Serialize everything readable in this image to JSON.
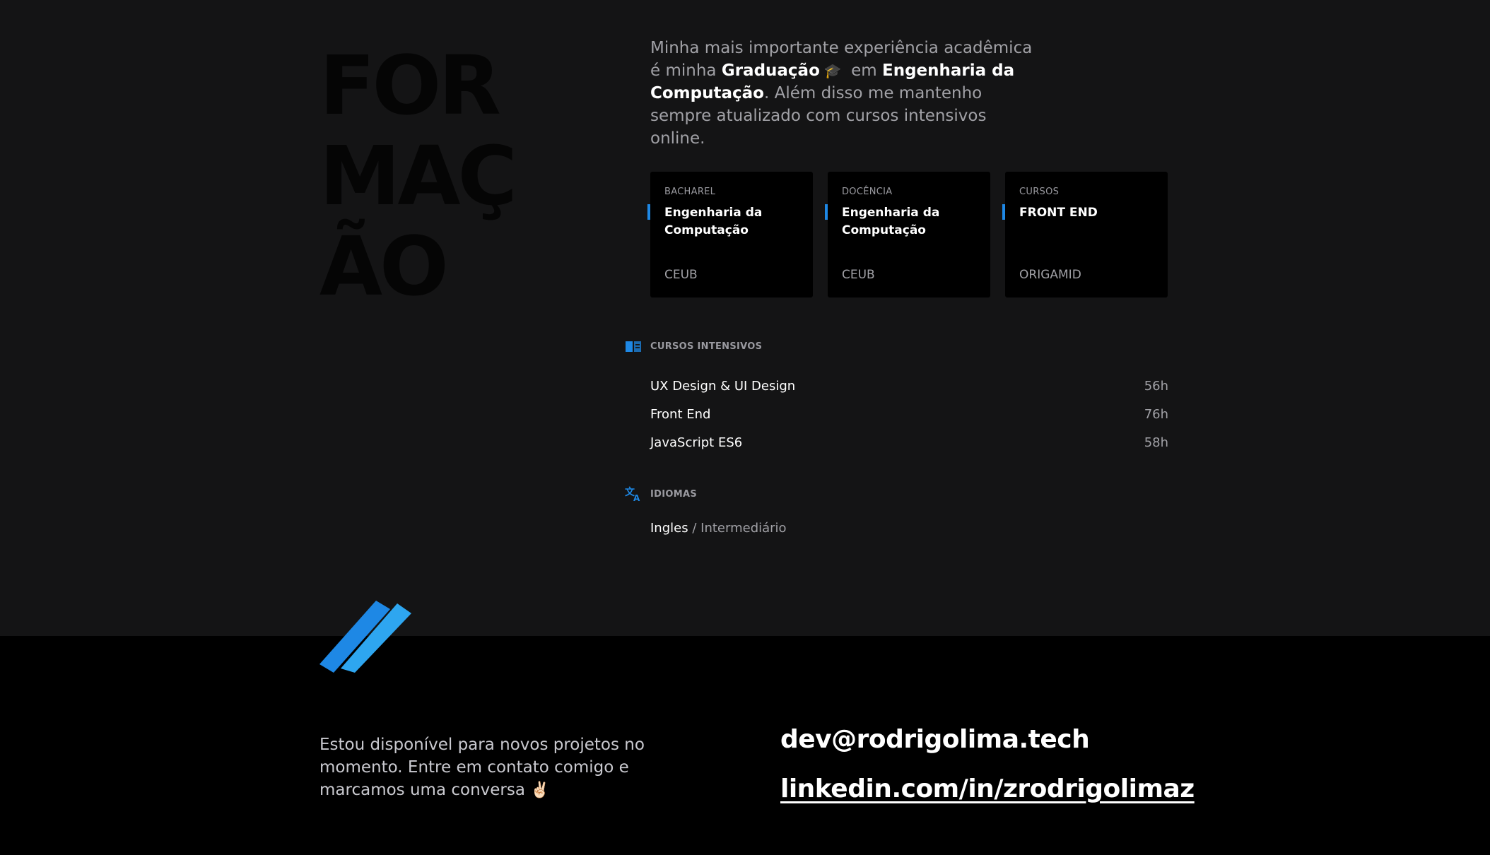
{
  "formacao": {
    "title": "FOR\nMAÇ\nÃO",
    "intro": {
      "prefix": "Minha mais importante experiência acadêmica é minha ",
      "graduacao": "Graduação",
      "emoji": "🎓",
      "em": " em ",
      "curso": "Engenharia da Computação",
      "suffix": ". Além disso me mantenho sempre atualizado com cursos intensivos online."
    },
    "cards": [
      {
        "kind": "BACHAREL",
        "degree": "Engenharia da Computação",
        "school": "CEUB"
      },
      {
        "kind": "DOCÊNCIA",
        "degree": "Engenharia da Computação",
        "school": "CEUB"
      },
      {
        "kind": "CURSOS",
        "degree": "FRONT END",
        "school": "ORIGAMID"
      }
    ],
    "cursos": {
      "label": "CURSOS INTENSIVOS",
      "icon": "book-icon",
      "items": [
        {
          "name": "UX Design & UI Design",
          "hours": "56h"
        },
        {
          "name": "Front End",
          "hours": "76h"
        },
        {
          "name": "JavaScript ES6",
          "hours": "58h"
        }
      ]
    },
    "idiomas": {
      "label": "IDIOMAS",
      "icon": "translate-icon",
      "language": "Ingles",
      "separator": "/",
      "level": "Intermediário"
    }
  },
  "footer": {
    "text": "Estou disponível para novos projetos no momento. Entre em contato comigo e marcamos uma conversa",
    "emoji": "✌🏻",
    "email": "dev@rodrigolima.tech",
    "linkedin": "linkedin.com/in/zrodrigolimaz"
  },
  "colors": {
    "accent": "#1e88e5",
    "accent_light": "#2ea6f0",
    "background": "#141415",
    "footer_background": "#000000",
    "card_background": "#000000",
    "muted_text": "#a1a1a6"
  }
}
